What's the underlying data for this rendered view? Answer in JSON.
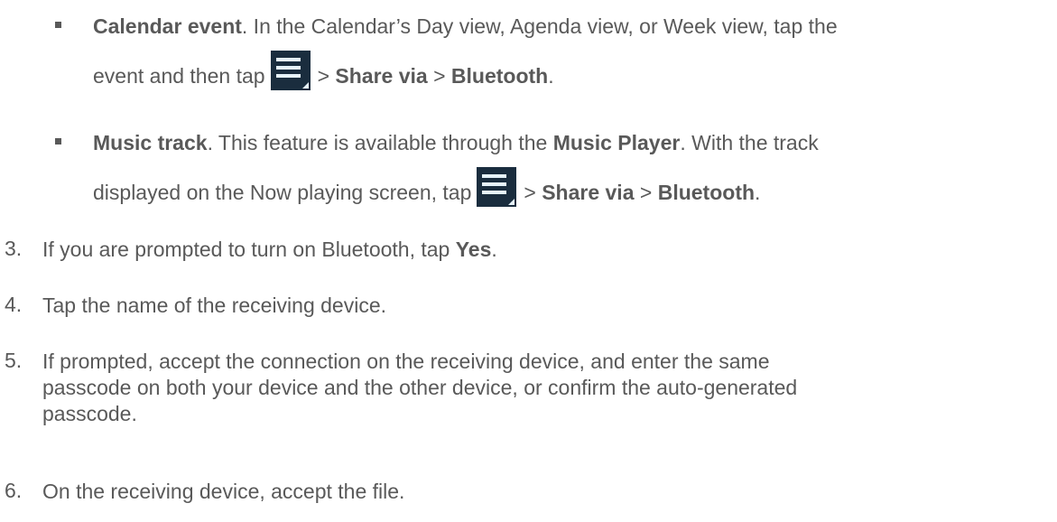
{
  "bullets": [
    {
      "title": "Calendar event",
      "line1_text": ". In the Calendar’s Day view, Agenda view, or Week view, tap the",
      "line2_prefix": "event and then tap",
      "sep1": ">",
      "share_via": "Share via",
      "sep2": ">",
      "bluetooth": "Bluetooth",
      "end": ".",
      "icon": "menu-icon"
    },
    {
      "title": "Music track",
      "line1_text": ". This feature is available through the ",
      "music_player": "Music Player",
      "line1_tail": ". With the track",
      "line2_prefix": "displayed on the Now playing screen, tap",
      "sep1": ">",
      "share_via": "Share via",
      "sep2": ">",
      "bluetooth": "Bluetooth",
      "end": ".",
      "icon": "menu-icon"
    }
  ],
  "steps": [
    {
      "num": "3.",
      "text": "If you are prompted to turn on Bluetooth, tap ",
      "bold": "Yes",
      "end": "."
    },
    {
      "num": "4.",
      "text": "Tap the name of the receiving device."
    },
    {
      "num": "5.",
      "line1": "If prompted, accept the connection on the receiving device, and enter the same",
      "line2": "passcode on both your device and the other device, or confirm the auto-generated",
      "line3": "passcode."
    },
    {
      "num": "6.",
      "text": "On the receiving device, accept the file."
    }
  ],
  "colors": {
    "text": "#595959",
    "icon_bg": "#1a2d3e",
    "icon_fg": "#e6f3fa"
  }
}
